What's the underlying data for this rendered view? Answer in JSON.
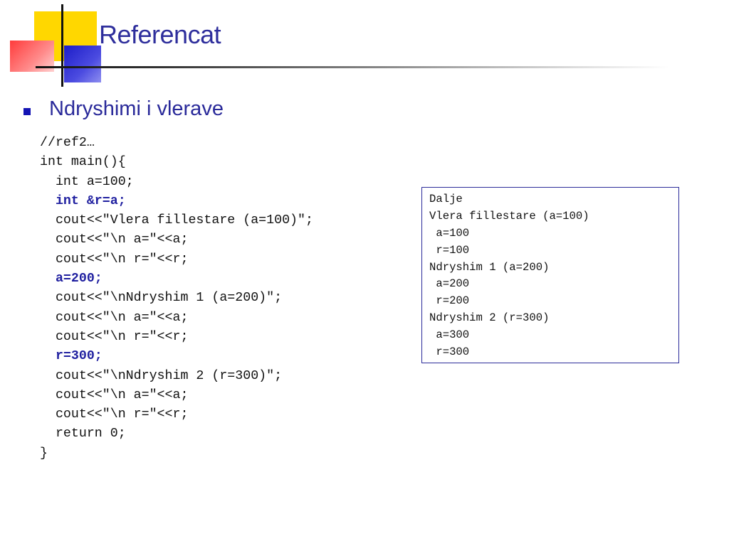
{
  "slide": {
    "title": "Referencat",
    "bullet": "Ndryshimi i vlerave"
  },
  "code_lines": [
    {
      "text": "//ref2…",
      "bold": false
    },
    {
      "text": "int main(){",
      "bold": false
    },
    {
      "text": "  int a=100;",
      "bold": false
    },
    {
      "text": "  int &r=a;",
      "bold": true
    },
    {
      "text": "  cout<<\"Vlera fillestare (a=100)\";",
      "bold": false
    },
    {
      "text": "  cout<<\"\\n a=\"<<a;",
      "bold": false
    },
    {
      "text": "  cout<<\"\\n r=\"<<r;",
      "bold": false
    },
    {
      "text": "  a=200;",
      "bold": true
    },
    {
      "text": "  cout<<\"\\nNdryshim 1 (a=200)\";",
      "bold": false
    },
    {
      "text": "  cout<<\"\\n a=\"<<a;",
      "bold": false
    },
    {
      "text": "  cout<<\"\\n r=\"<<r;",
      "bold": false
    },
    {
      "text": "  r=300;",
      "bold": true
    },
    {
      "text": "  cout<<\"\\nNdryshim 2 (r=300)\";",
      "bold": false
    },
    {
      "text": "  cout<<\"\\n a=\"<<a;",
      "bold": false
    },
    {
      "text": "  cout<<\"\\n r=\"<<r;",
      "bold": false
    },
    {
      "text": "  return 0;",
      "bold": false
    },
    {
      "text": "}",
      "bold": false
    }
  ],
  "output_lines": [
    "Dalje",
    "Vlera fillestare (a=100)",
    " a=100",
    " r=100",
    "Ndryshim 1 (a=200)",
    " a=200",
    " r=200",
    "Ndryshim 2 (r=300)",
    " a=300",
    " r=300"
  ],
  "colors": {
    "title": "#2e2e9c",
    "bullet": "#1414b4",
    "code_highlight": "#2020a0",
    "box_border": "#2b2b9a"
  }
}
